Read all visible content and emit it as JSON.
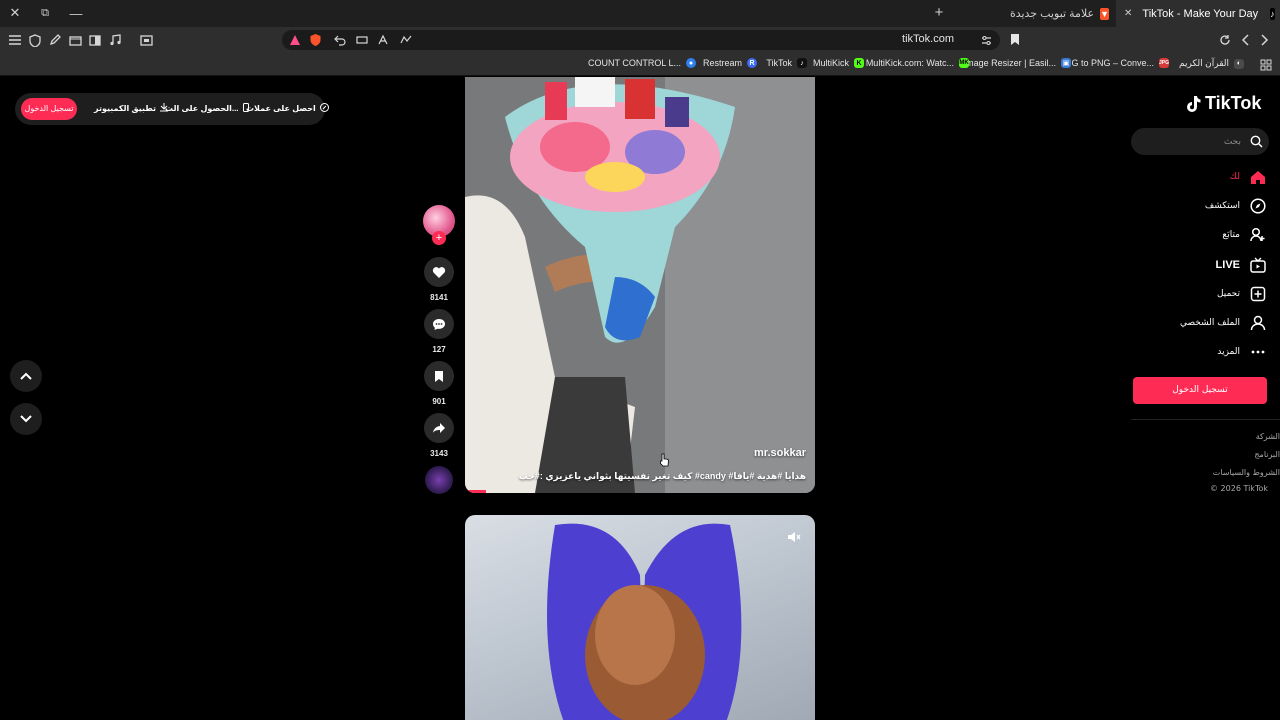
{
  "window": {
    "tabs": [
      {
        "label": "علامة تبويب جديدة",
        "active": false
      },
      {
        "label": "TikTok - Make Your Day",
        "active": true
      }
    ],
    "new_tab_symbol": "+",
    "controls": {
      "close": "✕",
      "restore": "⧉",
      "minimize": "—"
    }
  },
  "toolbar": {
    "url": "tikTok.com",
    "icons": [
      "menu-icon",
      "shield-icon",
      "pen-icon",
      "tabs-icon",
      "sidebar-icon",
      "music-icon",
      "screenshot-icon",
      "reload-icon",
      "back-icon",
      "forward-icon",
      "bookmark-icon",
      "brave-shield-icon",
      "leo-icon",
      "rewards-icon"
    ]
  },
  "bookmarks": [
    {
      "label": "القرآن الكريم",
      "color": "#4a4a4a",
      "glyph": "◐"
    },
    {
      "label": "JPG to PNG – Conve...",
      "color": "#d93a3a",
      "glyph": "JPG"
    },
    {
      "label": "Image Resizer | Easil...",
      "color": "#3a7bd5",
      "glyph": "▣"
    },
    {
      "label": "MultiKick.com: Watc...",
      "color": "#53fc18",
      "glyph": "MK"
    },
    {
      "label": "MultiKick",
      "color": "#53fc18",
      "glyph": "K"
    },
    {
      "label": "TikTok",
      "color": "#111111",
      "glyph": "♪"
    },
    {
      "label": "Restream",
      "color": "#3b6cf6",
      "glyph": "R"
    },
    {
      "label": "COUNT CONTROL L...",
      "color": "#2f80ed",
      "glyph": "●"
    }
  ],
  "topbar": {
    "coins": "احصل على عملات",
    "get_app": "الحصول على الت...",
    "desktop_app": "تطبيق الكمبيوتر",
    "login": "تسجيل الدخول"
  },
  "sidebar": {
    "logo": "TikTok",
    "search_placeholder": "بحث",
    "items": [
      {
        "label": "لك",
        "icon": "home-icon",
        "active": true
      },
      {
        "label": "استكشف",
        "icon": "compass-icon",
        "active": false
      },
      {
        "label": "متابَع",
        "icon": "following-icon",
        "active": false
      },
      {
        "label": "LIVE",
        "icon": "live-icon",
        "active": false
      },
      {
        "label": "تحميل",
        "icon": "upload-icon",
        "active": false
      },
      {
        "label": "الملف الشخصي",
        "icon": "profile-icon",
        "active": false
      },
      {
        "label": "المزيد",
        "icon": "more-icon",
        "active": false
      }
    ],
    "login": "تسجيل الدخول",
    "footer": [
      "الشركة",
      "البرنامج",
      "الشروط والسياسات",
      "© 2026 TikTok"
    ]
  },
  "video": {
    "author": "mr.sokkar",
    "caption": "كيف تغير نفسيتها بثواني ياعزيزي :#حب #candy #هدايا #هدية #يافا",
    "progress": 0.06,
    "likes": "8141",
    "comments": "127",
    "saves": "901",
    "shares": "3143"
  },
  "colors": {
    "accent": "#fe2c55",
    "background": "#000000",
    "chrome": "#2e2e2e"
  }
}
